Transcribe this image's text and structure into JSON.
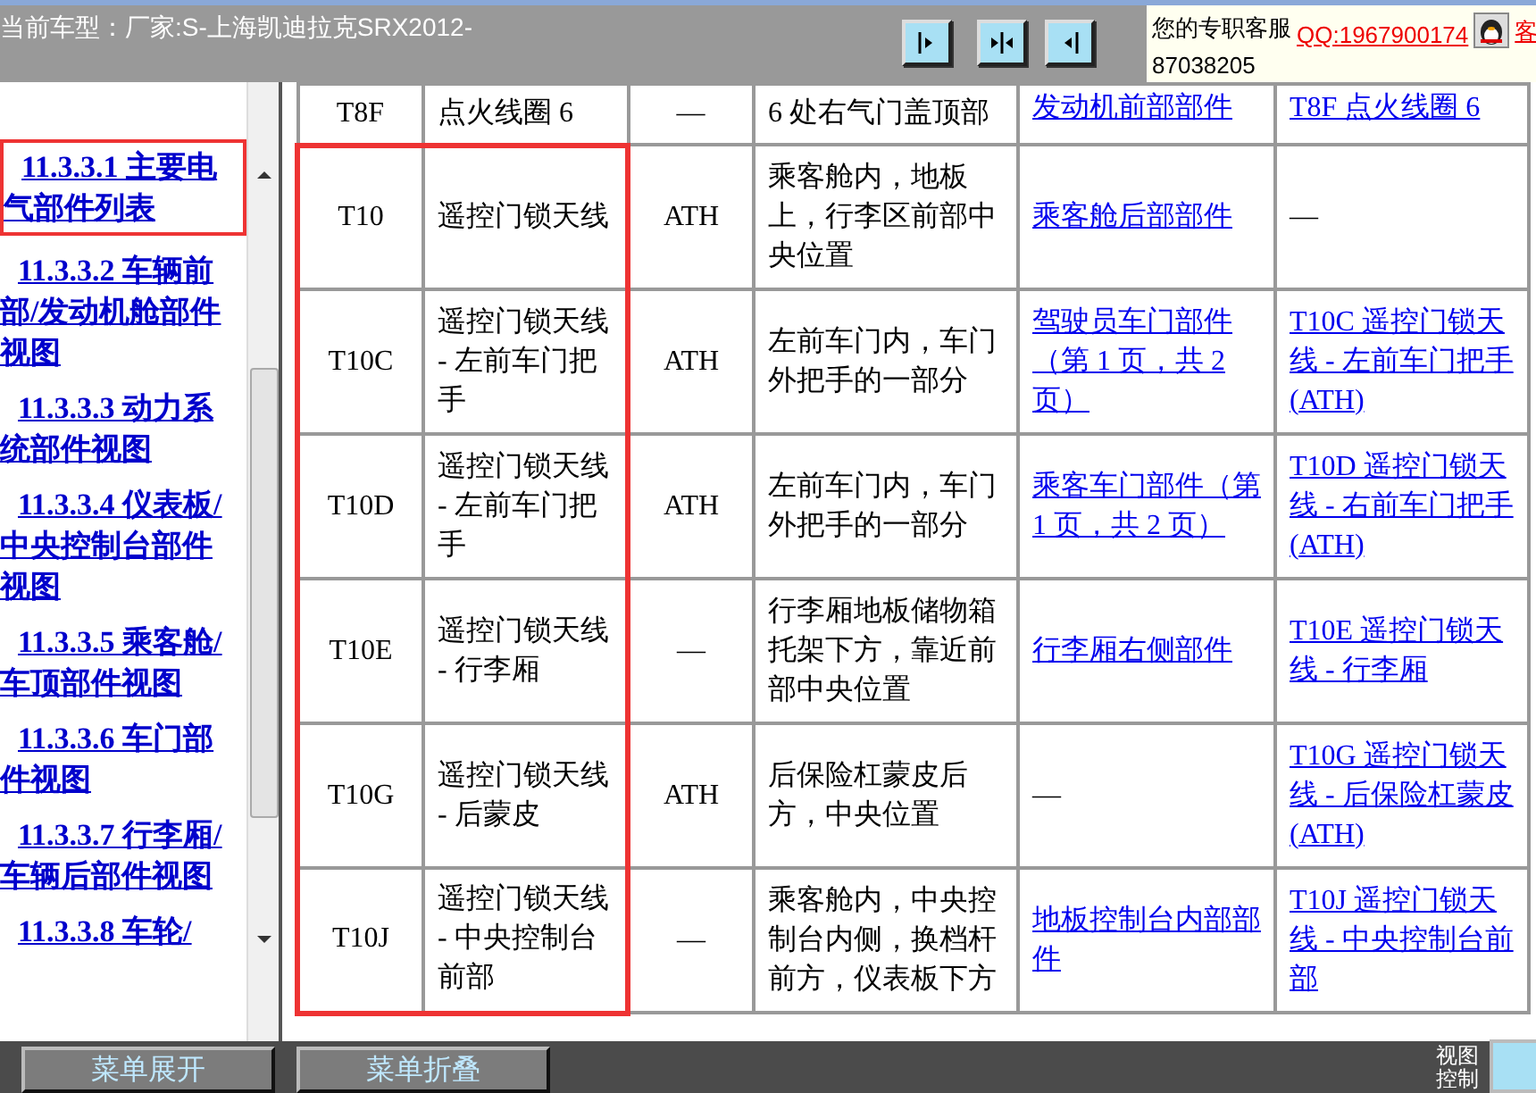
{
  "header": {
    "vehicle_label": "当前车型：",
    "vehicle": "厂家:S-上海凯迪拉克SRX2012-",
    "view_buttons": [
      {
        "kind": "right"
      },
      {
        "kind": "both"
      },
      {
        "kind": "left"
      }
    ],
    "service": {
      "title": "您的专职客服",
      "qq": "QQ:1967900174",
      "phone": "87038205",
      "cut_label": "客"
    }
  },
  "sidebar": {
    "items": [
      {
        "label": "11.3.3.1 主要电气部件列表",
        "selected": true
      },
      {
        "label": "11.3.3.2 车辆前部/发动机舱部件视图",
        "selected": false
      },
      {
        "label": "11.3.3.3 动力系统部件视图",
        "selected": false
      },
      {
        "label": "11.3.3.4 仪表板/中央控制台部件视图",
        "selected": false
      },
      {
        "label": "11.3.3.5 乘客舱/车顶部件视图",
        "selected": false
      },
      {
        "label": "11.3.3.6 车门部件视图",
        "selected": false
      },
      {
        "label": "11.3.3.7 行李厢/车辆后部件视图",
        "selected": false
      },
      {
        "label": "11.3.3.8 车轮/",
        "selected": false
      }
    ]
  },
  "table": {
    "rows": [
      {
        "marked": false,
        "cells": [
          {
            "text": "T8F",
            "kind": "text"
          },
          {
            "text": "点火线圈 6",
            "kind": "text"
          },
          {
            "text": "—",
            "kind": "text"
          },
          {
            "text": "6 处右气门盖顶部",
            "kind": "text"
          },
          {
            "text": "发动机前部部件",
            "kind": "link"
          },
          {
            "text": "T8F 点火线圈 6",
            "kind": "link"
          }
        ]
      },
      {
        "marked": true,
        "cells": [
          {
            "text": "T10",
            "kind": "text"
          },
          {
            "text": "遥控门锁天线",
            "kind": "text"
          },
          {
            "text": "ATH",
            "kind": "text"
          },
          {
            "text": "乘客舱内，地板上，行李区前部中央位置",
            "kind": "text"
          },
          {
            "text": "乘客舱后部部件",
            "kind": "link"
          },
          {
            "text": "—",
            "kind": "text"
          }
        ]
      },
      {
        "marked": true,
        "cells": [
          {
            "text": "T10C",
            "kind": "text"
          },
          {
            "text": "遥控门锁天线 - 左前车门把手",
            "kind": "text"
          },
          {
            "text": "ATH",
            "kind": "text"
          },
          {
            "text": "左前车门内，车门外把手的一部分",
            "kind": "text"
          },
          {
            "text": "驾驶员车门部件（第 1 页，共 2 页）",
            "kind": "link"
          },
          {
            "text": "T10C 遥控门锁天线 - 左前车门把手 (ATH)",
            "kind": "link"
          }
        ]
      },
      {
        "marked": true,
        "cells": [
          {
            "text": "T10D",
            "kind": "text"
          },
          {
            "text": "遥控门锁天线 - 左前车门把手",
            "kind": "text"
          },
          {
            "text": "ATH",
            "kind": "text"
          },
          {
            "text": "左前车门内，车门外把手的一部分",
            "kind": "text"
          },
          {
            "text": "乘客车门部件（第 1 页，共 2 页）",
            "kind": "link"
          },
          {
            "text": "T10D 遥控门锁天线 - 右前车门把手 (ATH)",
            "kind": "link"
          }
        ]
      },
      {
        "marked": true,
        "cells": [
          {
            "text": "T10E",
            "kind": "text"
          },
          {
            "text": "遥控门锁天线 - 行李厢",
            "kind": "text"
          },
          {
            "text": "—",
            "kind": "text"
          },
          {
            "text": "行李厢地板储物箱托架下方，靠近前部中央位置",
            "kind": "text"
          },
          {
            "text": "行李厢右侧部件",
            "kind": "link"
          },
          {
            "text": "T10E 遥控门锁天线 - 行李厢",
            "kind": "link"
          }
        ]
      },
      {
        "marked": true,
        "cells": [
          {
            "text": "T10G",
            "kind": "text"
          },
          {
            "text": "遥控门锁天线 - 后蒙皮",
            "kind": "text"
          },
          {
            "text": "ATH",
            "kind": "text"
          },
          {
            "text": "后保险杠蒙皮后方，中央位置",
            "kind": "text"
          },
          {
            "text": "—",
            "kind": "text"
          },
          {
            "text": "T10G 遥控门锁天线 - 后保险杠蒙皮 (ATH)",
            "kind": "link"
          }
        ]
      },
      {
        "marked": true,
        "cells": [
          {
            "text": "T10J",
            "kind": "text"
          },
          {
            "text": "遥控门锁天线 - 中央控制台前部",
            "kind": "text"
          },
          {
            "text": "—",
            "kind": "text"
          },
          {
            "text": "乘客舱内，中央控制台内侧，换档杆前方，仪表板下方",
            "kind": "text"
          },
          {
            "text": "地板控制台内部部件",
            "kind": "link"
          },
          {
            "text": "T10J 遥控门锁天线 - 中央控制台前部",
            "kind": "link"
          }
        ]
      }
    ]
  },
  "footer": {
    "buttons": [
      "菜单展开",
      "菜单折叠"
    ],
    "view_label": "视图控制"
  }
}
